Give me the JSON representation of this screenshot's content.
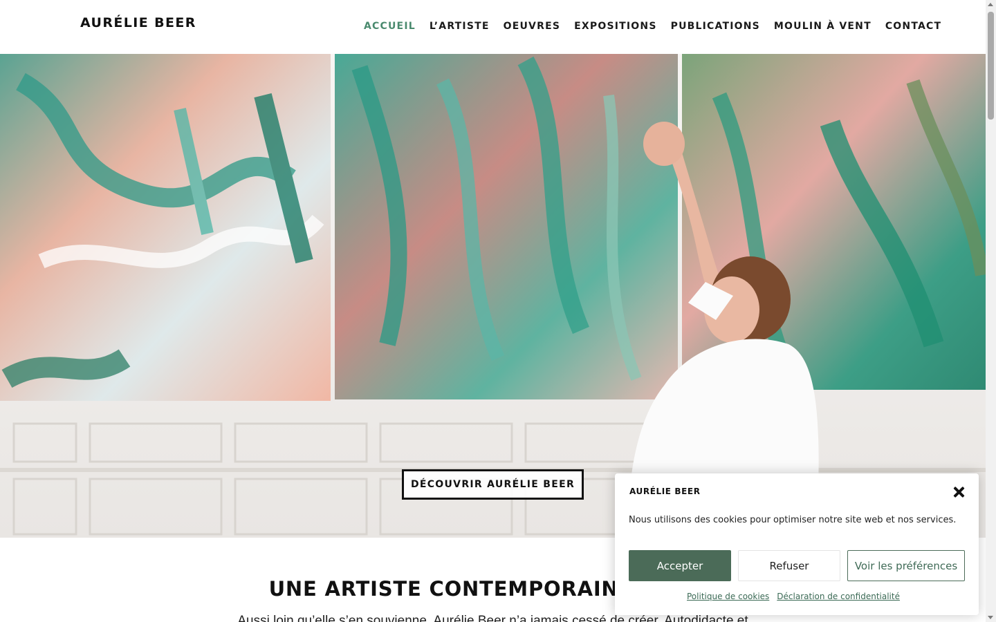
{
  "header": {
    "logo": "AURÉLIE BEER",
    "nav": [
      {
        "label": "ACCUEIL",
        "active": true
      },
      {
        "label": "L’ARTISTE",
        "active": false
      },
      {
        "label": "OEUVRES",
        "active": false
      },
      {
        "label": "EXPOSITIONS",
        "active": false
      },
      {
        "label": "PUBLICATIONS",
        "active": false
      },
      {
        "label": "MOULIN À VENT",
        "active": false
      },
      {
        "label": "CONTACT",
        "active": false
      }
    ]
  },
  "hero": {
    "button_label": "DÉCOUVRIR AURÉLIE BEER"
  },
  "content": {
    "title": "UNE ARTISTE CONTEMPORAINE AUX M",
    "intro": "Aussi loin qu’elle s’en souvienne, Aurélie Beer n’a jamais cessé de créer. Autodidacte et"
  },
  "cookie": {
    "title": "AURÉLIE BEER",
    "text": "Nous utilisons des cookies pour optimiser notre site web et nos services.",
    "accept_label": "Accepter",
    "refuse_label": "Refuser",
    "prefs_label": "Voir les préférences",
    "policy_link": "Politique de cookies",
    "privacy_link": "Déclaration de confidentialité"
  },
  "colors": {
    "accent": "#4a8a6e",
    "accept_bg": "#4b6b58"
  }
}
